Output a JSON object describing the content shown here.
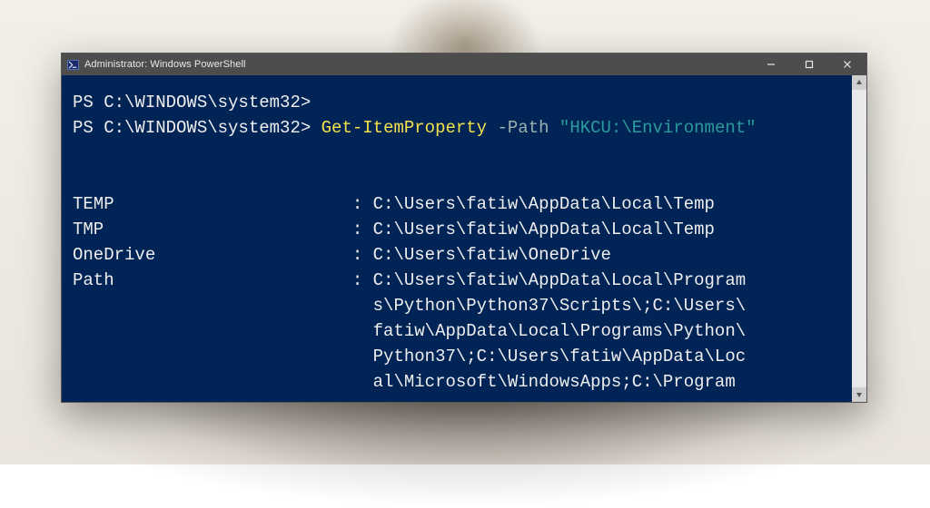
{
  "window": {
    "title": "Administrator: Windows PowerShell"
  },
  "prompt": {
    "line1_prompt": "PS C:\\WINDOWS\\system32>",
    "line2_prompt": "PS C:\\WINDOWS\\system32> ",
    "cmd_cmdlet": "Get-ItemProperty",
    "cmd_space1": " ",
    "cmd_param": "-Path",
    "cmd_space2": " ",
    "cmd_arg": "\"HKCU:\\Environment\""
  },
  "output": {
    "entries": [
      {
        "name": "TEMP",
        "sep": ": ",
        "lines": [
          "C:\\Users\\fatiw\\AppData\\Local\\Temp"
        ]
      },
      {
        "name": "TMP",
        "sep": ": ",
        "lines": [
          "C:\\Users\\fatiw\\AppData\\Local\\Temp"
        ]
      },
      {
        "name": "OneDrive",
        "sep": ": ",
        "lines": [
          "C:\\Users\\fatiw\\OneDrive"
        ]
      },
      {
        "name": "Path",
        "sep": ": ",
        "lines": [
          "C:\\Users\\fatiw\\AppData\\Local\\Program",
          "s\\Python\\Python37\\Scripts\\;C:\\Users\\",
          "fatiw\\AppData\\Local\\Programs\\Python\\",
          "Python37\\;C:\\Users\\fatiw\\AppData\\Loc",
          "al\\Microsoft\\WindowsApps;C:\\Program"
        ]
      }
    ],
    "name_col_width": 27
  }
}
